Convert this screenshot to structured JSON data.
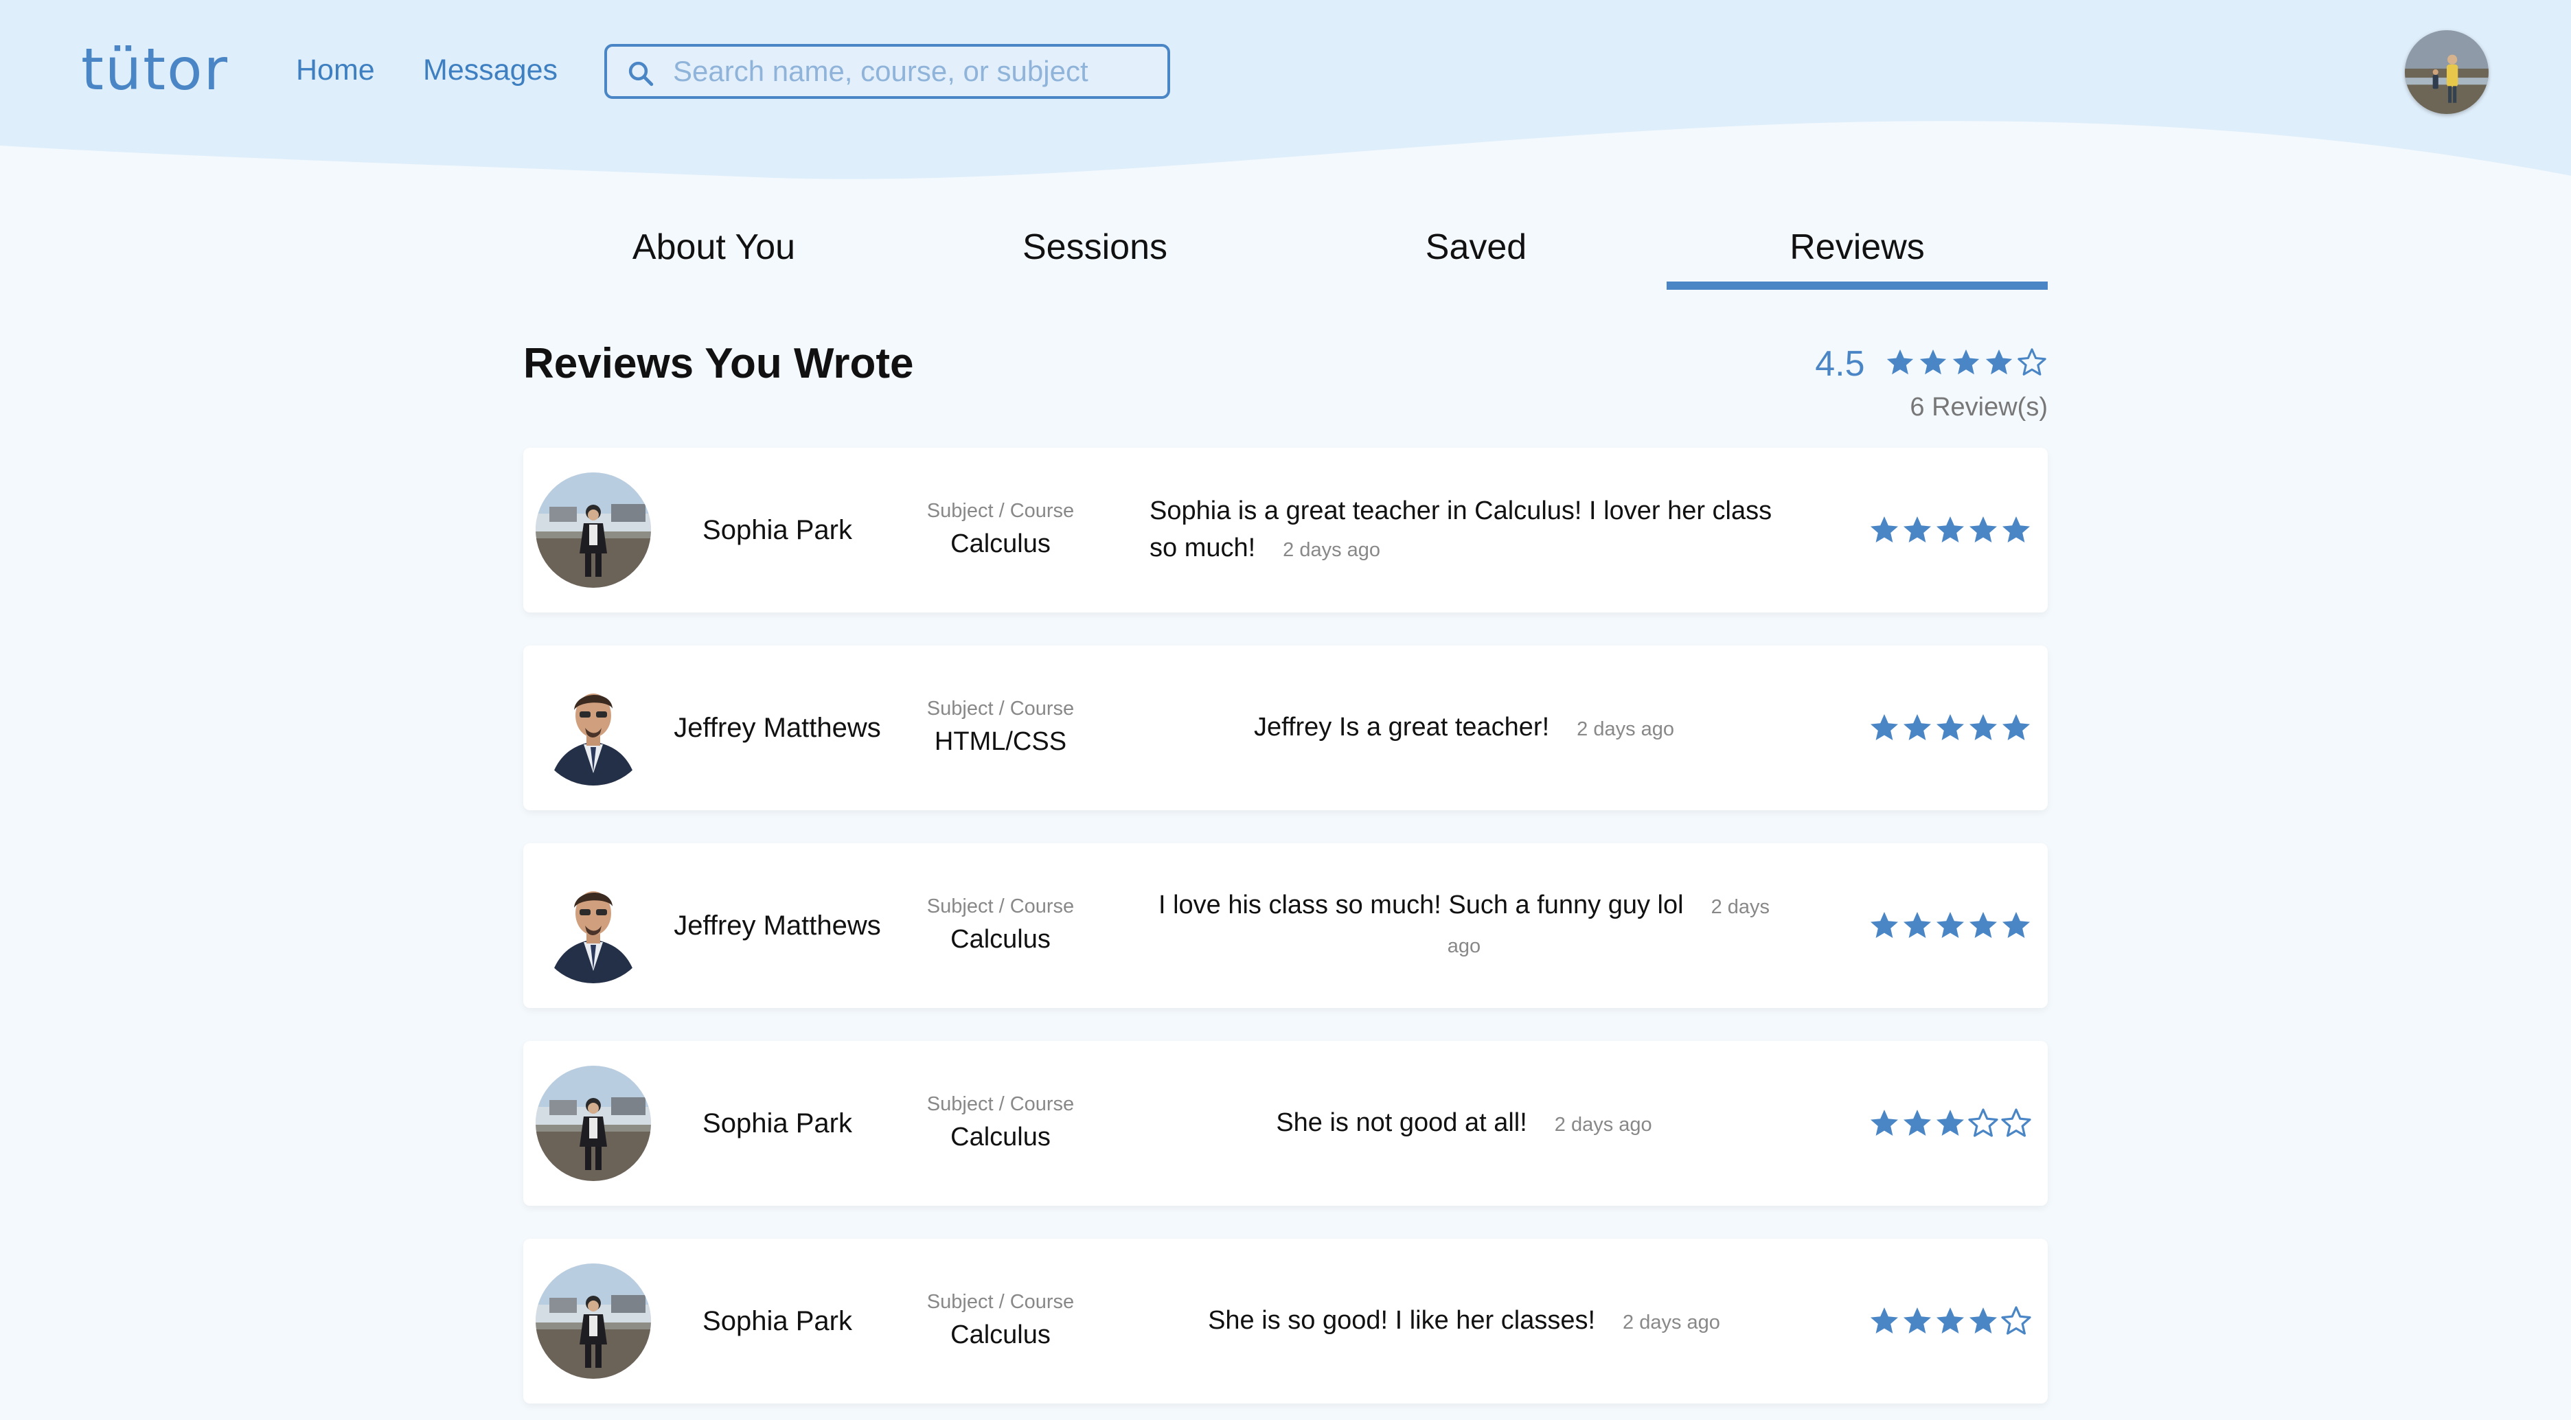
{
  "header": {
    "logo": "tütor",
    "nav": {
      "home": "Home",
      "messages": "Messages"
    },
    "search_placeholder": "Search name, course, or subject"
  },
  "tabs": [
    "About You",
    "Sessions",
    "Saved",
    "Reviews"
  ],
  "active_tab": "Reviews",
  "section": {
    "title": "Reviews You Wrote",
    "rating_value": "4.5",
    "rating_stars": 4.5,
    "review_count": "6 Review(s)"
  },
  "colors": {
    "accent": "#4a86c5",
    "header_bg": "#dfeefb",
    "page_bg": "#f4f9fd"
  },
  "reviews": [
    {
      "name": "Sophia Park",
      "course_label": "Subject / Course",
      "course": "Calculus",
      "comment": "Sophia is a great teacher in Calculus! I lover her class so much!",
      "ago": "2 days ago",
      "stars": 5,
      "avatar": "sophia"
    },
    {
      "name": "Jeffrey Matthews",
      "course_label": "Subject / Course",
      "course": "HTML/CSS",
      "comment": "Jeffrey Is a great teacher!",
      "ago": "2 days ago",
      "stars": 5,
      "avatar": "jeffrey"
    },
    {
      "name": "Jeffrey Matthews",
      "course_label": "Subject / Course",
      "course": "Calculus",
      "comment": "I love his class so much! Such a funny guy lol",
      "ago": "2 days ago",
      "stars": 5,
      "avatar": "jeffrey"
    },
    {
      "name": "Sophia Park",
      "course_label": "Subject / Course",
      "course": "Calculus",
      "comment": "She is not good at all!",
      "ago": "2 days ago",
      "stars": 3,
      "avatar": "sophia"
    },
    {
      "name": "Sophia Park",
      "course_label": "Subject / Course",
      "course": "Calculus",
      "comment": "She is so good! I like her classes!",
      "ago": "2 days ago",
      "stars": 4,
      "avatar": "sophia"
    }
  ]
}
